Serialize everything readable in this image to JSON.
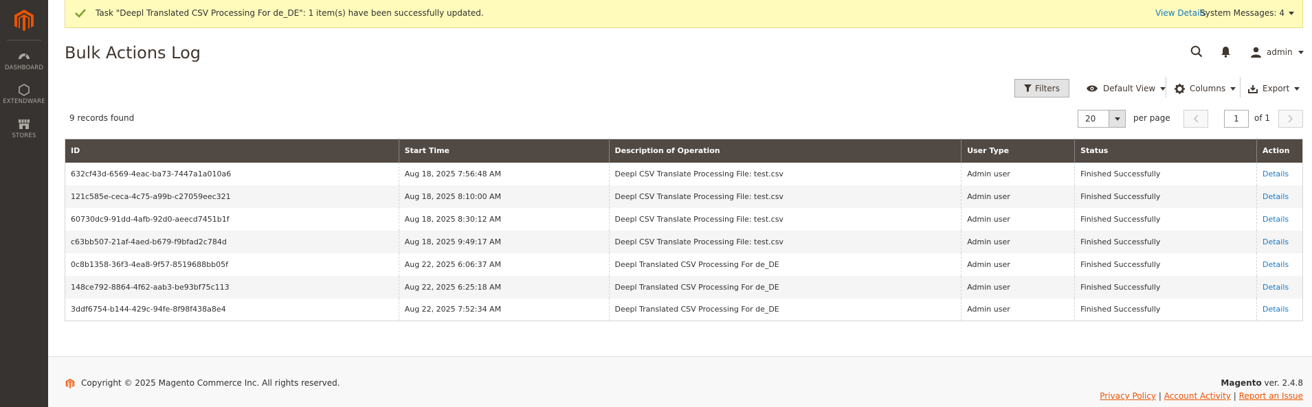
{
  "sidebar": {
    "items": [
      {
        "label": "DASHBOARD",
        "icon": "dashboard-icon"
      },
      {
        "label": "EXTENDWARE",
        "icon": "hexagon-icon"
      },
      {
        "label": "STORES",
        "icon": "store-icon"
      }
    ]
  },
  "message": {
    "text": "Task \"Deepl Translated CSV Processing For de_DE\": 1 item(s) have been successfully updated.",
    "view_details": "View Details",
    "system_messages": "System Messages: 4"
  },
  "page": {
    "title": "Bulk Actions Log"
  },
  "header": {
    "user": "admin"
  },
  "toolbar": {
    "filters": "Filters",
    "view": "Default View",
    "columns": "Columns",
    "export": "Export"
  },
  "grid": {
    "records_found": "9 records found",
    "per_page_value": "20",
    "per_page_label": "per page",
    "current_page": "1",
    "total_pages": "of 1",
    "columns": [
      "ID",
      "Start Time",
      "Description of Operation",
      "User Type",
      "Status",
      "Action"
    ],
    "rows": [
      [
        "632cf43d-6569-4eac-ba73-7447a1a010a6",
        "Aug 18, 2025 7:56:48 AM",
        "Deepl CSV Translate Processing File: test.csv",
        "Admin user",
        "Finished Successfully",
        "Details"
      ],
      [
        "121c585e-ceca-4c75-a99b-c27059eec321",
        "Aug 18, 2025 8:10:00 AM",
        "Deepl CSV Translate Processing File: test.csv",
        "Admin user",
        "Finished Successfully",
        "Details"
      ],
      [
        "60730dc9-91dd-4afb-92d0-aeecd7451b1f",
        "Aug 18, 2025 8:30:12 AM",
        "Deepl CSV Translate Processing File: test.csv",
        "Admin user",
        "Finished Successfully",
        "Details"
      ],
      [
        "c63bb507-21af-4aed-b679-f9bfad2c784d",
        "Aug 18, 2025 9:49:17 AM",
        "Deepl CSV Translate Processing File: test.csv",
        "Admin user",
        "Finished Successfully",
        "Details"
      ],
      [
        "0c8b1358-36f3-4ea8-9f57-8519688bb05f",
        "Aug 22, 2025 6:06:37 AM",
        "Deepl Translated CSV Processing For de_DE",
        "Admin user",
        "Finished Successfully",
        "Details"
      ],
      [
        "148ce792-8864-4f62-aab3-be93bf75c113",
        "Aug 22, 2025 6:25:18 AM",
        "Deepl Translated CSV Processing For de_DE",
        "Admin user",
        "Finished Successfully",
        "Details"
      ],
      [
        "3ddf6754-b144-429c-94fe-8f98f438a8e4",
        "Aug 22, 2025 7:52:34 AM",
        "Deepl Translated CSV Processing For de_DE",
        "Admin user",
        "Finished Successfully",
        "Details"
      ]
    ]
  },
  "footer": {
    "copyright": "Copyright © 2025 Magento Commerce Inc. All rights reserved.",
    "brand": "Magento",
    "version": " ver. 2.4.8",
    "links": [
      "Privacy Policy",
      "Account Activity",
      "Report an Issue"
    ],
    "separator": "|"
  },
  "colors": {
    "sidebar": "#373330",
    "grid_header": "#514943",
    "message_bg": "#fffbbb",
    "link": "#1979c3",
    "brand": "#eb5202",
    "success": "#79a22e"
  }
}
